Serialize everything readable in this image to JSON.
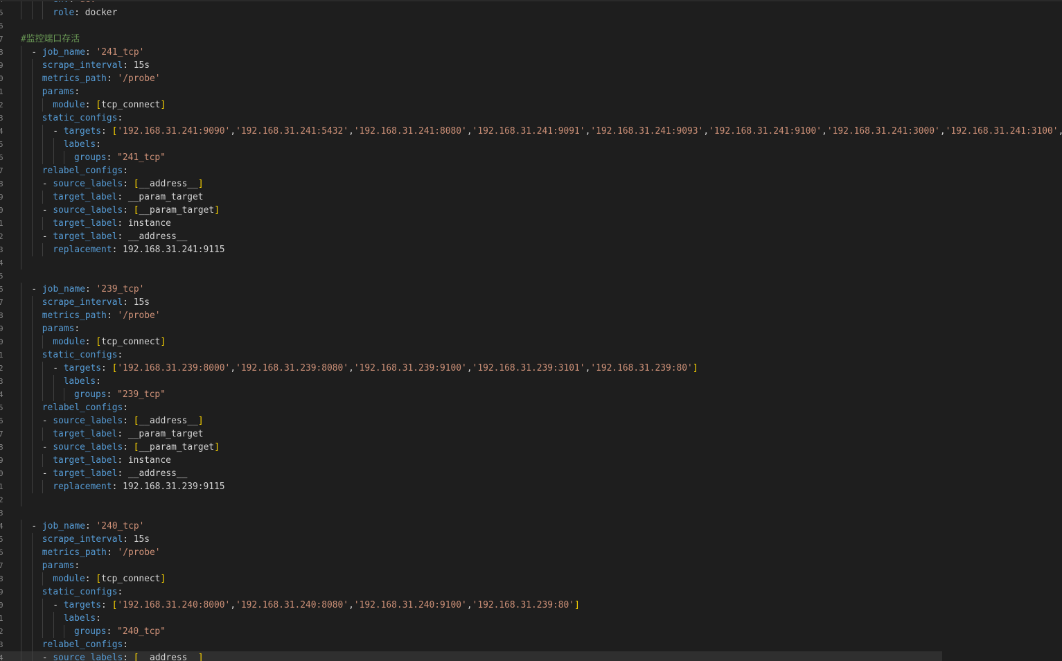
{
  "editor": {
    "language": "yaml",
    "colors": {
      "background": "#1e1e1e",
      "key": "#569cd6",
      "string": "#ce9178",
      "comment": "#6a9955",
      "bracket": "#ffd700",
      "text": "#d4d4d4",
      "line_number": "#858585"
    },
    "lines": [
      {
        "n": "4",
        "indent": 3,
        "tokens": [
          [
            "key",
            "env"
          ],
          [
            "punct",
            ": "
          ],
          [
            "str",
            "dev"
          ]
        ]
      },
      {
        "n": "5",
        "indent": 3,
        "tokens": [
          [
            "key",
            "role"
          ],
          [
            "punct",
            ": "
          ],
          [
            "plain",
            "docker"
          ]
        ]
      },
      {
        "n": "6",
        "indent": 0,
        "tokens": []
      },
      {
        "n": "7",
        "indent": 0,
        "tokens": [
          [
            "comment",
            "#监控端口存活"
          ]
        ]
      },
      {
        "n": "8",
        "indent": 1,
        "tokens": [
          [
            "punct",
            "- "
          ],
          [
            "key",
            "job_name"
          ],
          [
            "punct",
            ": "
          ],
          [
            "str",
            "'241_tcp'"
          ]
        ]
      },
      {
        "n": "9",
        "indent": 2,
        "tokens": [
          [
            "key",
            "scrape_interval"
          ],
          [
            "punct",
            ": "
          ],
          [
            "plain",
            "15s"
          ]
        ]
      },
      {
        "n": "0",
        "indent": 2,
        "tokens": [
          [
            "key",
            "metrics_path"
          ],
          [
            "punct",
            ": "
          ],
          [
            "str",
            "'/probe'"
          ]
        ]
      },
      {
        "n": "1",
        "indent": 2,
        "tokens": [
          [
            "key",
            "params"
          ],
          [
            "punct",
            ":"
          ]
        ]
      },
      {
        "n": "2",
        "indent": 3,
        "tokens": [
          [
            "key",
            "module"
          ],
          [
            "punct",
            ": "
          ],
          [
            "br",
            "["
          ],
          [
            "plain",
            "tcp_connect"
          ],
          [
            "br",
            "]"
          ]
        ]
      },
      {
        "n": "3",
        "indent": 2,
        "tokens": [
          [
            "key",
            "static_configs"
          ],
          [
            "punct",
            ":"
          ]
        ]
      },
      {
        "n": "4",
        "indent": 3,
        "tokens": [
          [
            "punct",
            "- "
          ],
          [
            "key",
            "targets"
          ],
          [
            "punct",
            ": "
          ],
          [
            "br",
            "["
          ],
          [
            "str",
            "'192.168.31.241:9090'"
          ],
          [
            "punct",
            ","
          ],
          [
            "str",
            "'192.168.31.241:5432'"
          ],
          [
            "punct",
            ","
          ],
          [
            "str",
            "'192.168.31.241:8080'"
          ],
          [
            "punct",
            ","
          ],
          [
            "str",
            "'192.168.31.241:9091'"
          ],
          [
            "punct",
            ","
          ],
          [
            "str",
            "'192.168.31.241:9093'"
          ],
          [
            "punct",
            ","
          ],
          [
            "str",
            "'192.168.31.241:9100'"
          ],
          [
            "punct",
            ","
          ],
          [
            "str",
            "'192.168.31.241:3000'"
          ],
          [
            "punct",
            ","
          ],
          [
            "str",
            "'192.168.31.241:3100'"
          ],
          [
            "punct",
            ","
          ],
          [
            "str",
            "'"
          ]
        ]
      },
      {
        "n": "5",
        "indent": 4,
        "tokens": [
          [
            "key",
            "labels"
          ],
          [
            "punct",
            ":"
          ]
        ]
      },
      {
        "n": "6",
        "indent": 5,
        "tokens": [
          [
            "key",
            "groups"
          ],
          [
            "punct",
            ": "
          ],
          [
            "str",
            "\"241_tcp\""
          ]
        ]
      },
      {
        "n": "7",
        "indent": 2,
        "tokens": [
          [
            "key",
            "relabel_configs"
          ],
          [
            "punct",
            ":"
          ]
        ]
      },
      {
        "n": "8",
        "indent": 2,
        "tokens": [
          [
            "punct",
            "- "
          ],
          [
            "key",
            "source_labels"
          ],
          [
            "punct",
            ": "
          ],
          [
            "br",
            "["
          ],
          [
            "plain",
            "__address__"
          ],
          [
            "br",
            "]"
          ]
        ]
      },
      {
        "n": "9",
        "indent": 3,
        "tokens": [
          [
            "key",
            "target_label"
          ],
          [
            "punct",
            ": "
          ],
          [
            "plain",
            "__param_target"
          ]
        ]
      },
      {
        "n": "0",
        "indent": 2,
        "tokens": [
          [
            "punct",
            "- "
          ],
          [
            "key",
            "source_labels"
          ],
          [
            "punct",
            ": "
          ],
          [
            "br",
            "["
          ],
          [
            "plain",
            "__param_target"
          ],
          [
            "br",
            "]"
          ]
        ]
      },
      {
        "n": "1",
        "indent": 3,
        "tokens": [
          [
            "key",
            "target_label"
          ],
          [
            "punct",
            ": "
          ],
          [
            "plain",
            "instance"
          ]
        ]
      },
      {
        "n": "2",
        "indent": 2,
        "tokens": [
          [
            "punct",
            "- "
          ],
          [
            "key",
            "target_label"
          ],
          [
            "punct",
            ": "
          ],
          [
            "plain",
            "__address__"
          ]
        ]
      },
      {
        "n": "3",
        "indent": 3,
        "tokens": [
          [
            "key",
            "replacement"
          ],
          [
            "punct",
            ": "
          ],
          [
            "plain",
            "192.168.31.241:9115"
          ]
        ]
      },
      {
        "n": "4",
        "indent": 1,
        "tokens": []
      },
      {
        "n": "5",
        "indent": 0,
        "tokens": []
      },
      {
        "n": "6",
        "indent": 1,
        "tokens": [
          [
            "punct",
            "- "
          ],
          [
            "key",
            "job_name"
          ],
          [
            "punct",
            ": "
          ],
          [
            "str",
            "'239_tcp'"
          ]
        ]
      },
      {
        "n": "7",
        "indent": 2,
        "tokens": [
          [
            "key",
            "scrape_interval"
          ],
          [
            "punct",
            ": "
          ],
          [
            "plain",
            "15s"
          ]
        ]
      },
      {
        "n": "8",
        "indent": 2,
        "tokens": [
          [
            "key",
            "metrics_path"
          ],
          [
            "punct",
            ": "
          ],
          [
            "str",
            "'/probe'"
          ]
        ]
      },
      {
        "n": "9",
        "indent": 2,
        "tokens": [
          [
            "key",
            "params"
          ],
          [
            "punct",
            ":"
          ]
        ]
      },
      {
        "n": "0",
        "indent": 3,
        "tokens": [
          [
            "key",
            "module"
          ],
          [
            "punct",
            ": "
          ],
          [
            "br",
            "["
          ],
          [
            "plain",
            "tcp_connect"
          ],
          [
            "br",
            "]"
          ]
        ]
      },
      {
        "n": "1",
        "indent": 2,
        "tokens": [
          [
            "key",
            "static_configs"
          ],
          [
            "punct",
            ":"
          ]
        ]
      },
      {
        "n": "2",
        "indent": 3,
        "tokens": [
          [
            "punct",
            "- "
          ],
          [
            "key",
            "targets"
          ],
          [
            "punct",
            ": "
          ],
          [
            "br",
            "["
          ],
          [
            "str",
            "'192.168.31.239:8000'"
          ],
          [
            "punct",
            ","
          ],
          [
            "str",
            "'192.168.31.239:8080'"
          ],
          [
            "punct",
            ","
          ],
          [
            "str",
            "'192.168.31.239:9100'"
          ],
          [
            "punct",
            ","
          ],
          [
            "str",
            "'192.168.31.239:3101'"
          ],
          [
            "punct",
            ","
          ],
          [
            "str",
            "'192.168.31.239:80'"
          ],
          [
            "br",
            "]"
          ]
        ]
      },
      {
        "n": "3",
        "indent": 4,
        "tokens": [
          [
            "key",
            "labels"
          ],
          [
            "punct",
            ":"
          ]
        ]
      },
      {
        "n": "4",
        "indent": 5,
        "tokens": [
          [
            "key",
            "groups"
          ],
          [
            "punct",
            ": "
          ],
          [
            "str",
            "\"239_tcp\""
          ]
        ]
      },
      {
        "n": "5",
        "indent": 2,
        "tokens": [
          [
            "key",
            "relabel_configs"
          ],
          [
            "punct",
            ":"
          ]
        ]
      },
      {
        "n": "6",
        "indent": 2,
        "tokens": [
          [
            "punct",
            "- "
          ],
          [
            "key",
            "source_labels"
          ],
          [
            "punct",
            ": "
          ],
          [
            "br",
            "["
          ],
          [
            "plain",
            "__address__"
          ],
          [
            "br",
            "]"
          ]
        ]
      },
      {
        "n": "7",
        "indent": 3,
        "tokens": [
          [
            "key",
            "target_label"
          ],
          [
            "punct",
            ": "
          ],
          [
            "plain",
            "__param_target"
          ]
        ]
      },
      {
        "n": "8",
        "indent": 2,
        "tokens": [
          [
            "punct",
            "- "
          ],
          [
            "key",
            "source_labels"
          ],
          [
            "punct",
            ": "
          ],
          [
            "br",
            "["
          ],
          [
            "plain",
            "__param_target"
          ],
          [
            "br",
            "]"
          ]
        ]
      },
      {
        "n": "9",
        "indent": 3,
        "tokens": [
          [
            "key",
            "target_label"
          ],
          [
            "punct",
            ": "
          ],
          [
            "plain",
            "instance"
          ]
        ]
      },
      {
        "n": "0",
        "indent": 2,
        "tokens": [
          [
            "punct",
            "- "
          ],
          [
            "key",
            "target_label"
          ],
          [
            "punct",
            ": "
          ],
          [
            "plain",
            "__address__"
          ]
        ]
      },
      {
        "n": "1",
        "indent": 3,
        "tokens": [
          [
            "key",
            "replacement"
          ],
          [
            "punct",
            ": "
          ],
          [
            "plain",
            "192.168.31.239:9115"
          ]
        ]
      },
      {
        "n": "2",
        "indent": 1,
        "tokens": []
      },
      {
        "n": "3",
        "indent": 0,
        "tokens": []
      },
      {
        "n": "4",
        "indent": 1,
        "tokens": [
          [
            "punct",
            "- "
          ],
          [
            "key",
            "job_name"
          ],
          [
            "punct",
            ": "
          ],
          [
            "str",
            "'240_tcp'"
          ]
        ]
      },
      {
        "n": "5",
        "indent": 2,
        "tokens": [
          [
            "key",
            "scrape_interval"
          ],
          [
            "punct",
            ": "
          ],
          [
            "plain",
            "15s"
          ]
        ]
      },
      {
        "n": "6",
        "indent": 2,
        "tokens": [
          [
            "key",
            "metrics_path"
          ],
          [
            "punct",
            ": "
          ],
          [
            "str",
            "'/probe'"
          ]
        ]
      },
      {
        "n": "7",
        "indent": 2,
        "tokens": [
          [
            "key",
            "params"
          ],
          [
            "punct",
            ":"
          ]
        ]
      },
      {
        "n": "8",
        "indent": 3,
        "tokens": [
          [
            "key",
            "module"
          ],
          [
            "punct",
            ": "
          ],
          [
            "br",
            "["
          ],
          [
            "plain",
            "tcp_connect"
          ],
          [
            "br",
            "]"
          ]
        ]
      },
      {
        "n": "9",
        "indent": 2,
        "tokens": [
          [
            "key",
            "static_configs"
          ],
          [
            "punct",
            ":"
          ]
        ]
      },
      {
        "n": "0",
        "indent": 3,
        "tokens": [
          [
            "punct",
            "- "
          ],
          [
            "key",
            "targets"
          ],
          [
            "punct",
            ": "
          ],
          [
            "br",
            "["
          ],
          [
            "str",
            "'192.168.31.240:8000'"
          ],
          [
            "punct",
            ","
          ],
          [
            "str",
            "'192.168.31.240:8080'"
          ],
          [
            "punct",
            ","
          ],
          [
            "str",
            "'192.168.31.240:9100'"
          ],
          [
            "punct",
            ","
          ],
          [
            "str",
            "'192.168.31.239:80'"
          ],
          [
            "br",
            "]"
          ]
        ]
      },
      {
        "n": "1",
        "indent": 4,
        "tokens": [
          [
            "key",
            "labels"
          ],
          [
            "punct",
            ":"
          ]
        ]
      },
      {
        "n": "2",
        "indent": 5,
        "tokens": [
          [
            "key",
            "groups"
          ],
          [
            "punct",
            ": "
          ],
          [
            "str",
            "\"240_tcp\""
          ]
        ]
      },
      {
        "n": "3",
        "indent": 2,
        "tokens": [
          [
            "key",
            "relabel_configs"
          ],
          [
            "punct",
            ":"
          ]
        ]
      },
      {
        "n": "4",
        "indent": 2,
        "current": true,
        "tokens": [
          [
            "punct",
            "- "
          ],
          [
            "key",
            "source_labels"
          ],
          [
            "punct",
            ": "
          ],
          [
            "br",
            "["
          ],
          [
            "plain",
            "__address__"
          ],
          [
            "br",
            "]"
          ]
        ]
      }
    ]
  }
}
